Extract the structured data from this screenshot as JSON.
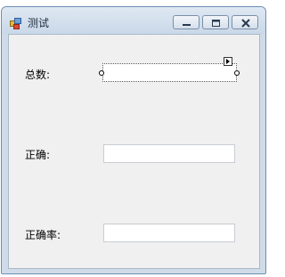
{
  "window": {
    "title": "测试",
    "icon": "windows-form-icon",
    "controls": [
      "minimize-icon",
      "maximize-icon",
      "close-icon"
    ]
  },
  "form": {
    "total_label": "总数:",
    "total_value": "",
    "correct_label": "正确:",
    "correct_value": "",
    "rate_label": "正确率:",
    "rate_value": ""
  }
}
